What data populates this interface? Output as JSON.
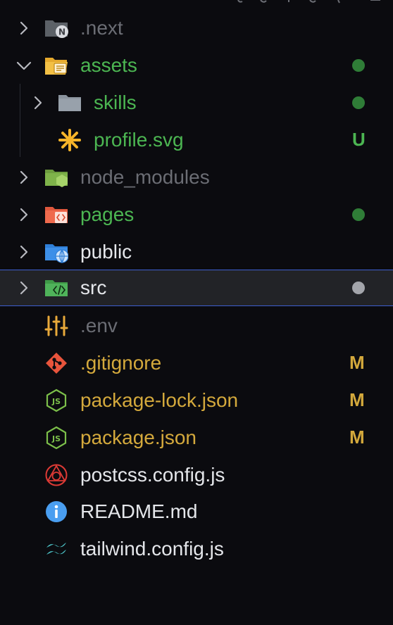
{
  "colors": {
    "background": "#0b0b0f",
    "selected_row": "#222327",
    "selection_border": "#3e5fd0",
    "git_added": "#4cb652",
    "git_modified": "#d4a93c",
    "ignored": "#6b6d74",
    "normal": "#e4e6ea",
    "chevron": "#b8bac0"
  },
  "tree": [
    {
      "label": ".next",
      "icon": "nextjs-folder-icon",
      "expanded": false,
      "state": "ignored"
    },
    {
      "label": "assets",
      "icon": "folder-open-icon",
      "expanded": true,
      "state": "added",
      "decoration": "dot"
    },
    {
      "label": "skills",
      "icon": "folder-icon",
      "expanded": false,
      "state": "added",
      "decoration": "dot"
    },
    {
      "label": "profile.svg",
      "icon": "svg-file-icon",
      "state": "added",
      "decoration": "U"
    },
    {
      "label": "node_modules",
      "icon": "node-folder-icon",
      "expanded": false,
      "state": "ignored"
    },
    {
      "label": "pages",
      "icon": "pages-folder-icon",
      "expanded": false,
      "state": "added",
      "decoration": "dot"
    },
    {
      "label": "public",
      "icon": "public-folder-icon",
      "expanded": false,
      "state": "normal"
    },
    {
      "label": "src",
      "icon": "src-folder-icon",
      "expanded": false,
      "state": "normal",
      "selected": true,
      "decoration": "dot"
    },
    {
      "label": ".env",
      "icon": "env-settings-icon",
      "state": "ignored"
    },
    {
      "label": ".gitignore",
      "icon": "git-icon",
      "state": "modified",
      "decoration": "M"
    },
    {
      "label": "package-lock.json",
      "icon": "nodejs-file-icon",
      "state": "modified",
      "decoration": "M"
    },
    {
      "label": "package.json",
      "icon": "nodejs-file-icon",
      "state": "modified",
      "decoration": "M"
    },
    {
      "label": "postcss.config.js",
      "icon": "postcss-icon",
      "state": "normal"
    },
    {
      "label": "README.md",
      "icon": "info-icon",
      "state": "normal"
    },
    {
      "label": "tailwind.config.js",
      "icon": "tailwind-icon",
      "state": "normal"
    }
  ]
}
